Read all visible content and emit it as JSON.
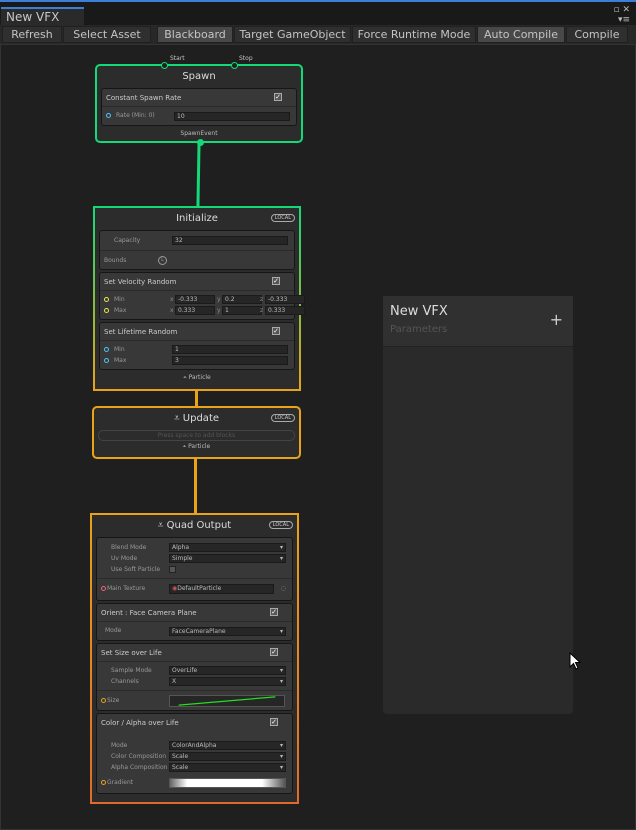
{
  "window": {
    "tab": "New VFX",
    "icons": [
      "maximize-icon",
      "close-icon",
      "menu-icon"
    ]
  },
  "toolbar": {
    "buttons": [
      {
        "label": "Refresh",
        "on": false
      },
      {
        "label": "Select Asset",
        "on": false
      },
      {
        "label": "Blackboard",
        "on": true
      },
      {
        "label": "Target GameObject",
        "on": false
      },
      {
        "label": "Force Runtime Mode",
        "on": false
      },
      {
        "label": "Auto Compile",
        "on": true
      },
      {
        "label": "Compile",
        "on": false
      }
    ]
  },
  "colors": {
    "spawn": "#14d977",
    "particle": "#e8a317",
    "output": "#e06a2c"
  },
  "spawn": {
    "title": "Spawn",
    "ports": [
      "Start",
      "Stop"
    ],
    "block": {
      "title": "Constant Spawn Rate",
      "rate_label": "Rate (Min: 0)",
      "rate": "10"
    },
    "footer": "SpawnEvent"
  },
  "initialize": {
    "title": "Initialize",
    "badge": "LOCAL",
    "capacity_label": "Capacity",
    "capacity": "32",
    "bounds_label": "Bounds",
    "bounds_badge": "L",
    "velocity": {
      "title": "Set Velocity Random",
      "min_label": "Min",
      "max_label": "Max",
      "min": [
        "-0.333",
        "0.2",
        "-0.333"
      ],
      "max": [
        "0.333",
        "1",
        "0.333"
      ],
      "axes": [
        "x",
        "y",
        "z"
      ]
    },
    "lifetime": {
      "title": "Set Lifetime Random",
      "min_label": "Min",
      "max_label": "Max",
      "min": "1",
      "max": "3"
    },
    "footer": "Particle"
  },
  "update": {
    "title": "Update",
    "badge": "LOCAL",
    "placeholder": "Press space to add blocks",
    "footer": "Particle"
  },
  "output": {
    "title": "Quad Output",
    "badge": "LOCAL",
    "blend_label": "Blend Mode",
    "blend": "Alpha",
    "uv_label": "Uv Mode",
    "uv": "Simple",
    "soft_label": "Use Soft Particle",
    "soft": false,
    "texture_label": "Main Texture",
    "texture": "DefaultParticle",
    "orient": {
      "title": "Orient : Face Camera Plane",
      "mode_label": "Mode",
      "mode": "FaceCameraPlane"
    },
    "size": {
      "title": "Set Size over Life",
      "sample_label": "Sample Mode",
      "sample": "OverLife",
      "channels_label": "Channels",
      "channels": "X",
      "size_label": "Size"
    },
    "color": {
      "title": "Color / Alpha over Life",
      "mode_label": "Mode",
      "mode": "ColorAndAlpha",
      "colorcomp_label": "Color Composition",
      "colorcomp": "Scale",
      "alphacomp_label": "Alpha Composition",
      "alphacomp": "Scale",
      "gradient_label": "Gradient"
    }
  },
  "blackboard": {
    "title": "New VFX",
    "subtitle": "Parameters",
    "add_icon": "plus-icon"
  }
}
